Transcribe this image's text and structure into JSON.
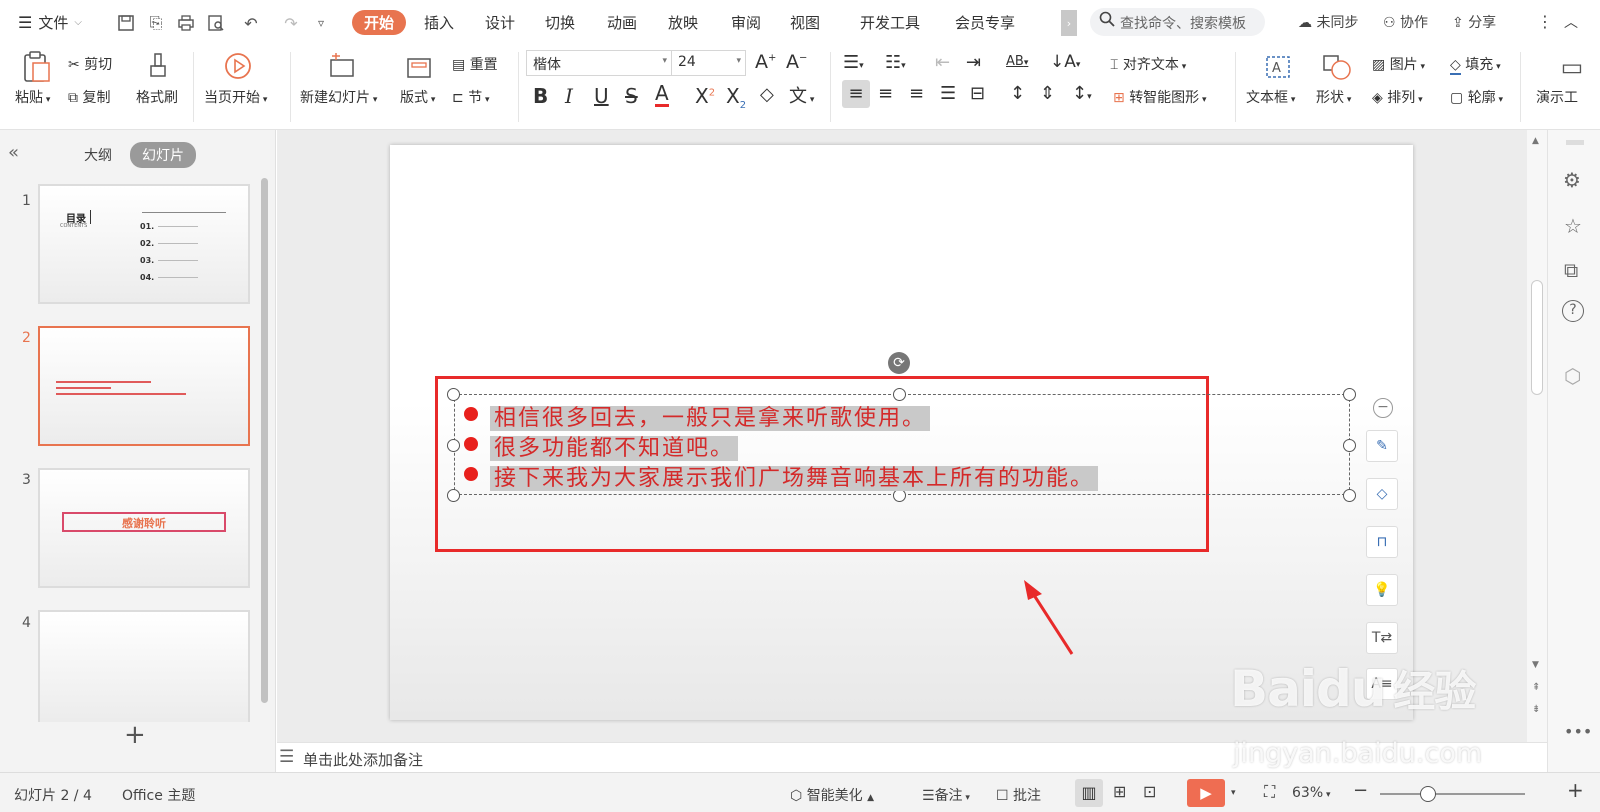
{
  "tabbar": {
    "file_menu": "文件",
    "tabs": [
      "开始",
      "插入",
      "设计",
      "切换",
      "动画",
      "放映",
      "审阅",
      "视图",
      "开发工具",
      "会员专享"
    ],
    "search_placeholder": "查找命令、搜索模板",
    "unsync": "未同步",
    "collab": "协作",
    "share": "分享"
  },
  "ribbon": {
    "paste": "粘贴",
    "cut": "剪切",
    "copy": "复制",
    "format_painter": "格式刷",
    "start_from_current": "当页开始",
    "new_slide": "新建幻灯片",
    "layout": "版式",
    "reset": "重置",
    "section": "节",
    "font_name": "楷体",
    "font_size": "24",
    "align_text": "对齐文本",
    "smart_art": "转智能图形",
    "text_box": "文本框",
    "shape": "形状",
    "picture": "图片",
    "arrange": "排列",
    "fill": "填充",
    "outline": "轮廓",
    "presentation_tools": "演示工"
  },
  "leftpanel": {
    "outline_tab": "大纲",
    "slides_tab": "幻灯片",
    "thumb1": {
      "title": "目录",
      "subtitle": "CONTENTS",
      "items": [
        "01.",
        "02.",
        "03.",
        "04."
      ]
    },
    "thumb3_text": "感谢聆听",
    "slide_numbers": [
      "1",
      "2",
      "3",
      "4"
    ]
  },
  "slide": {
    "lines": [
      "相信很多回去，一般只是拿来听歌使用。",
      "很多功能都不知道吧。",
      "接下来我为大家展示我们广场舞音响基本上所有的功能。"
    ]
  },
  "notes": {
    "placeholder": "单击此处添加备注"
  },
  "status": {
    "slide_info": "幻灯片 2 / 4",
    "theme": "Office 主题",
    "beautify": "智能美化",
    "notes": "备注",
    "comments": "批注",
    "zoom": "63%"
  },
  "watermark": {
    "brand": "Baidu",
    "cn": "经验",
    "url": "jingyan.baidu.com"
  },
  "colors": {
    "accent": "#e8744f",
    "red": "#e82a2a",
    "text_red": "#d42a2a"
  }
}
